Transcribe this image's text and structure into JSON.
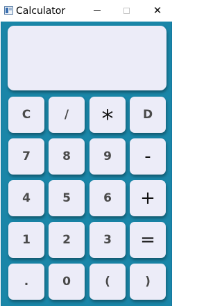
{
  "window": {
    "title": "Calculator",
    "minimize_glyph": "",
    "maximize_glyph": "",
    "close_glyph": "✕"
  },
  "display": {
    "value": ""
  },
  "keys": {
    "clear": "C",
    "divide": "/",
    "multiply": "*",
    "delete": "D",
    "seven": "7",
    "eight": "8",
    "nine": "9",
    "minus": "-",
    "four": "4",
    "five": "5",
    "six": "6",
    "plus": "+",
    "one": "1",
    "two": "2",
    "three": "3",
    "equals": "=",
    "dot": ".",
    "zero": "0",
    "open_paren": "(",
    "close_paren": ")"
  },
  "colors": {
    "background": "#1a86a8",
    "key_face": "#ececf8",
    "key_text": "#4a4a4a"
  }
}
